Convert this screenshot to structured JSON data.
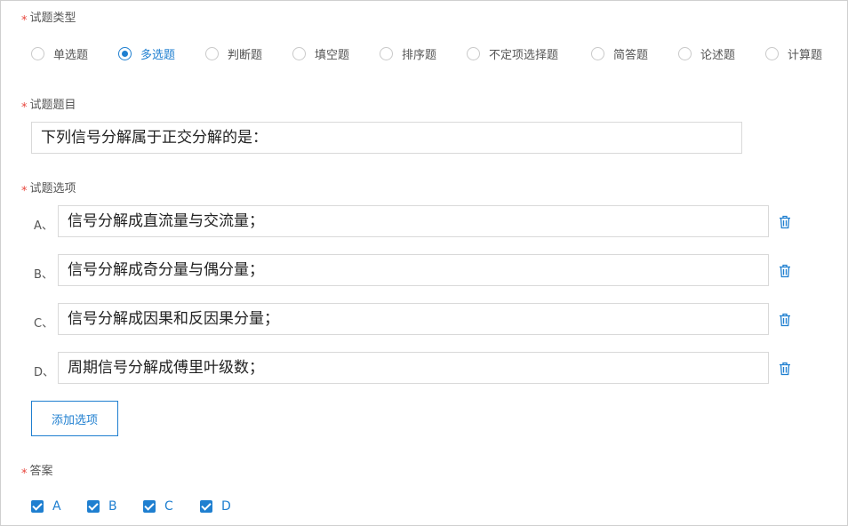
{
  "type_section": {
    "label": "试题类型",
    "options": [
      {
        "label": "单选题",
        "checked": false
      },
      {
        "label": "多选题",
        "checked": true
      },
      {
        "label": "判断题",
        "checked": false
      },
      {
        "label": "填空题",
        "checked": false
      },
      {
        "label": "排序题",
        "checked": false
      },
      {
        "label": "不定项选择题",
        "checked": false
      },
      {
        "label": "简答题",
        "checked": false
      },
      {
        "label": "论述题",
        "checked": false
      },
      {
        "label": "计算题",
        "checked": false
      }
    ]
  },
  "question_section": {
    "label": "试题题目",
    "value": "下列信号分解属于正交分解的是："
  },
  "options_section": {
    "label": "试题选项",
    "items": [
      {
        "letter": "A、",
        "value": "信号分解成直流量与交流量；"
      },
      {
        "letter": "B、",
        "value": "信号分解成奇分量与偶分量；"
      },
      {
        "letter": "C、",
        "value": "信号分解成因果和反因果分量；"
      },
      {
        "letter": "D、",
        "value": "周期信号分解成傅里叶级数；"
      }
    ],
    "add_button": "添加选项"
  },
  "answer_section": {
    "label": "答案",
    "choices": [
      {
        "label": "A",
        "checked": true
      },
      {
        "label": "B",
        "checked": true
      },
      {
        "label": "C",
        "checked": true
      },
      {
        "label": "D",
        "checked": true
      }
    ]
  },
  "colors": {
    "accent": "#1f7fd0",
    "required": "#e8453c"
  }
}
